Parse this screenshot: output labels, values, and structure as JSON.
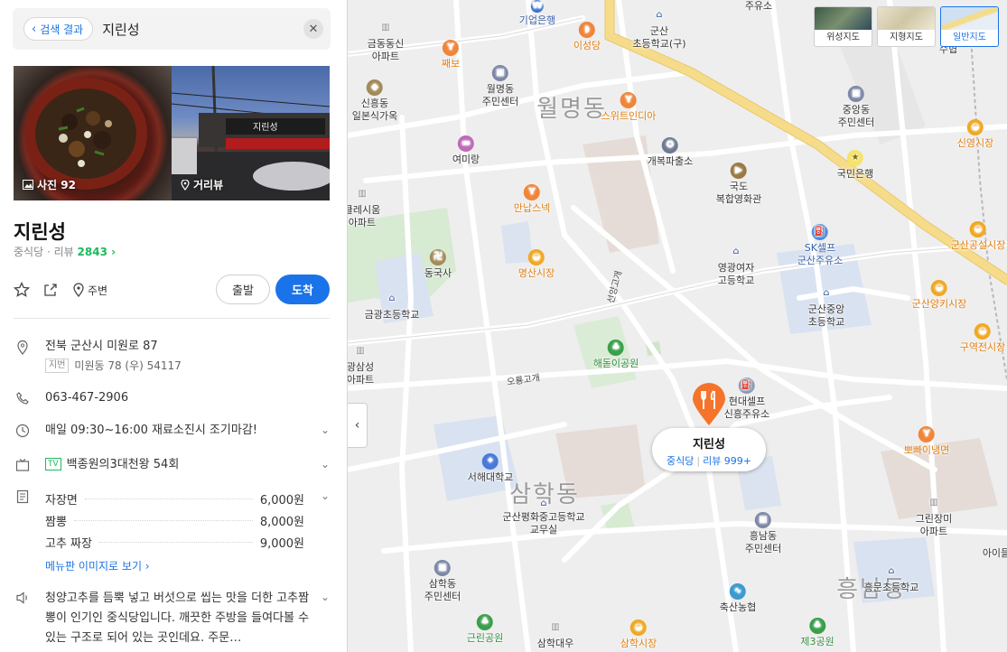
{
  "search": {
    "back_label": "검색 결과",
    "query": "지린성"
  },
  "photos": {
    "photo_label": "사진 92",
    "street_label": "거리뷰"
  },
  "place": {
    "name": "지린성",
    "category": "중식당",
    "review_prefix": "리뷰",
    "review_count": "2843 ›",
    "nearby_label": "주변",
    "depart_label": "출발",
    "arrive_label": "도착"
  },
  "info": {
    "address": "전북 군산시 미원로 87",
    "lot_tag": "지번",
    "lot_address": "미원동 78 (우) 54117",
    "phone": "063-467-2906",
    "hours": "매일 09:30~16:00 재료소진시 조기마감!",
    "tv_tag": "TV",
    "tv_show": "백종원의3대천왕 54회",
    "menu": [
      {
        "name": "자장면",
        "price": "6,000원"
      },
      {
        "name": "짬뽕",
        "price": "8,000원"
      },
      {
        "name": "고추 짜장",
        "price": "9,000원"
      }
    ],
    "menu_link": "메뉴판 이미지로 보기 ›",
    "description": "청양고추를 듬뿍 넣고 버섯으로 씹는 맛을 더한 고추짬뽕이 인기인 중식당입니다. 깨끗한 주방을 들여다볼 수 있는 구조로 되어 있는 곳인데요. 주문…"
  },
  "map": {
    "area_names": [
      "월명동",
      "삼학동",
      "흥남동"
    ],
    "pois": {
      "p1": "기업은행",
      "p2": "군산\n초등학교(구)",
      "p3": "이성당",
      "p4": "금동동신\n아파트",
      "p5": "째보",
      "p6": "월명동\n주민센터",
      "p7": "신흥동\n일본식가옥",
      "p8": "스위트인디아",
      "p9": "중앙동\n주민센터",
      "p10": "여미랑",
      "p11": "개복파출소",
      "p12": "국민은행",
      "p13": "신영시장",
      "p14": "국도\n복합영화관",
      "p15": "만납스넥",
      "p16": "클레시움\n아파트",
      "p17": "SK셀프\n군산주유소",
      "p18": "동국사",
      "p19": "영광여자\n고등학교",
      "p20": "군산공설시장",
      "p21": "명산시장",
      "p22": "금광초등학교",
      "p23": "군산중앙\n초등학교",
      "p24": "군산양키시장",
      "p25": "해돋이공원",
      "p26": "광삼성\n아파트",
      "p27": "구역전시장",
      "p28": "현대셀프\n신흥주유소",
      "p29": "서해대학교",
      "p30": "뽀빠이냉면",
      "p31": "군산평화중고등학교\n교무실",
      "p32": "흥남동\n주민센터",
      "p33": "그린장미\n아파트",
      "p34": "삼학동\n주민센터",
      "p35": "흥문초등학교",
      "p36": "축산농협",
      "p37": "근린공원",
      "p38": "삼학대우",
      "p39": "삼학시장",
      "p40": "제3공원",
      "p41": "아이들",
      "p42": "주유소",
      "p43": "수협"
    },
    "road_labels": {
      "r1": "오룡고개",
      "r2": "선양고개"
    },
    "callout": {
      "name": "지린성",
      "category": "중식당",
      "review": "리뷰 999+"
    },
    "map_types": [
      "위성지도",
      "지형지도",
      "일반지도"
    ]
  },
  "colors": {
    "accent": "#1a73e8",
    "green": "#1db95c",
    "pin": "#f5732a",
    "main_road": "#f6dc8a"
  }
}
